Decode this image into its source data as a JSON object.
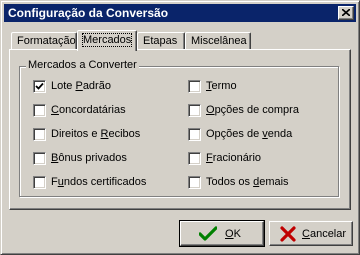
{
  "window": {
    "title": "Configuração da Conversão"
  },
  "tabs": [
    {
      "label": "Formatação",
      "active": false
    },
    {
      "label": "Mercados",
      "active": true
    },
    {
      "label": "Etapas",
      "active": false
    },
    {
      "label": "Miscelânea",
      "active": false
    }
  ],
  "group": {
    "legend": "Mercados a Converter"
  },
  "markets_left": [
    {
      "pre": "Lote ",
      "accel": "P",
      "post": "adrão",
      "checked": true
    },
    {
      "pre": "",
      "accel": "C",
      "post": "oncordatárias",
      "checked": false
    },
    {
      "pre": "Direitos e ",
      "accel": "R",
      "post": "ecibos",
      "checked": false
    },
    {
      "pre": "",
      "accel": "B",
      "post": "ônus privados",
      "checked": false
    },
    {
      "pre": "F",
      "accel": "u",
      "post": "ndos certificados",
      "checked": false
    }
  ],
  "markets_right": [
    {
      "pre": "",
      "accel": "T",
      "post": "ermo",
      "checked": false
    },
    {
      "pre": "",
      "accel": "O",
      "post": "pções de compra",
      "checked": false
    },
    {
      "pre": "Opções de ",
      "accel": "v",
      "post": "enda",
      "checked": false
    },
    {
      "pre": "",
      "accel": "F",
      "post": "racionário",
      "checked": false
    },
    {
      "pre": "Todos os ",
      "accel": "d",
      "post": "emais",
      "checked": false
    }
  ],
  "buttons": {
    "ok": {
      "pre": "",
      "accel": "O",
      "post": "K"
    },
    "cancel": {
      "pre": "",
      "accel": "C",
      "post": "ancelar"
    }
  },
  "colors": {
    "titlebar": "#0a246a",
    "face": "#d4d0c8",
    "ok_icon": "#008000",
    "cancel_icon": "#c00000"
  }
}
